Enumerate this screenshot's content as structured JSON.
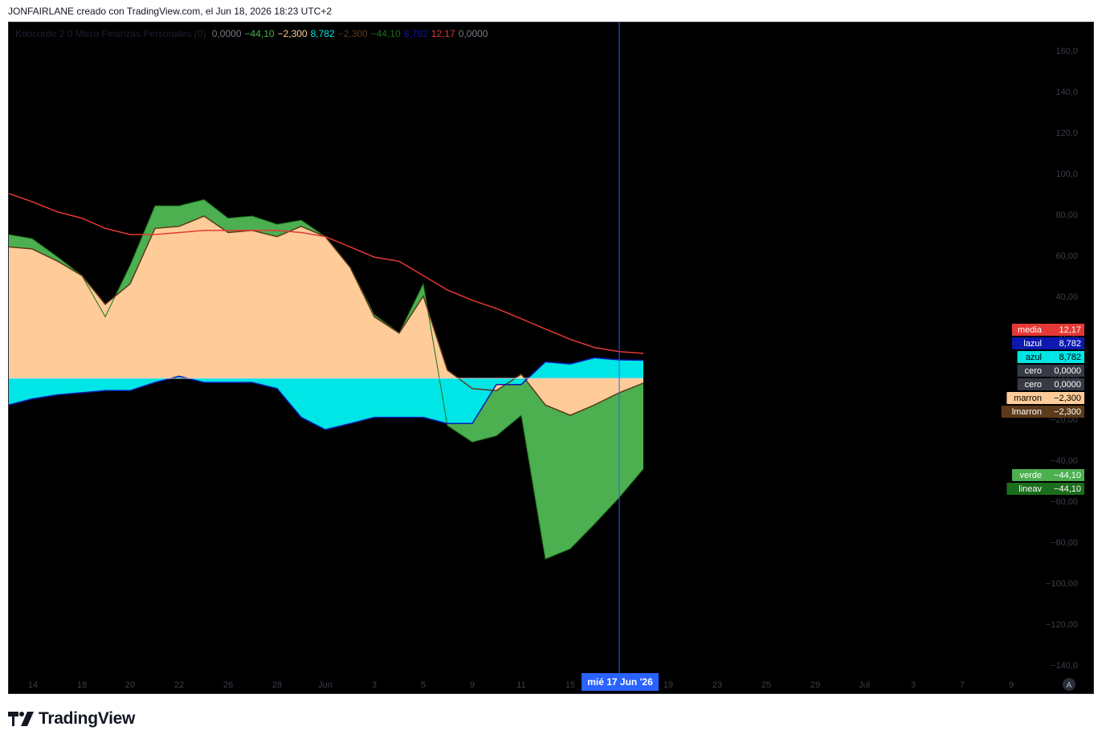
{
  "header": {
    "text": "JONFAIRLANE creado con TradingView.com, el Jun 18, 2026 18:23 UTC+2"
  },
  "legend": {
    "indicator": "Koncorde 2.0 Micro Finanzas Personales (0)",
    "values": [
      {
        "text": "0,0000",
        "color": "#787b86"
      },
      {
        "text": "−44,10",
        "color": "#4caf50"
      },
      {
        "text": "−2,300",
        "color": "#ffcc99"
      },
      {
        "text": "8,782",
        "color": "#00e5e5"
      },
      {
        "text": "−2,300",
        "color": "#5d3a1a"
      },
      {
        "text": "−44,10",
        "color": "#1b6e1b"
      },
      {
        "text": "8,782",
        "color": "#0d18b0"
      },
      {
        "text": "12,17",
        "color": "#e53935"
      },
      {
        "text": "0,0000",
        "color": "#787b86"
      }
    ]
  },
  "crosshair": {
    "date_label": "mié 17 Jun '26"
  },
  "footer": {
    "brand": "TradingView"
  },
  "chart_data": {
    "type": "area",
    "x": [
      "May 13",
      "May 15",
      "May 17",
      "May 19",
      "May 20",
      "May 21",
      "May 23",
      "May 24",
      "May 26",
      "May 28",
      "May 30",
      "Jun 1",
      "Jun 2",
      "Jun 3",
      "Jun 4",
      "Jun 5",
      "Jun 7",
      "Jun 8",
      "Jun 9",
      "Jun 10",
      "Jun 11",
      "Jun 12",
      "Jun 14",
      "Jun 15",
      "Jun 16",
      "Jun 17",
      "Jun 18"
    ],
    "x_ticks": [
      "14",
      "18",
      "20",
      "22",
      "26",
      "28",
      "Jun",
      "3",
      "5",
      "9",
      "11",
      "15",
      "19",
      "23",
      "25",
      "29",
      "Jul",
      "3",
      "7",
      "9"
    ],
    "y_ticks": [
      "160,0",
      "140,0",
      "120,0",
      "100,0",
      "80,00",
      "60,00",
      "40,00",
      "20,00",
      "0,0000",
      "−20,00",
      "−40,00",
      "−60,00",
      "−80,00",
      "−100,00",
      "−120,00",
      "−140,0"
    ],
    "ylim": [
      -140,
      160
    ],
    "series": [
      {
        "name": "verde",
        "color": "#4caf50",
        "values": [
          70,
          68,
          59,
          50,
          30,
          55,
          84,
          84,
          87,
          78,
          79,
          75,
          77,
          69,
          54,
          31,
          22,
          46,
          -23,
          -31,
          -28,
          -18,
          -88,
          -83,
          -71,
          -58,
          -44.1
        ]
      },
      {
        "name": "lineav",
        "color": "#1b6e1b",
        "values": [
          70,
          68,
          59,
          50,
          30,
          55,
          84,
          84,
          87,
          78,
          79,
          75,
          77,
          69,
          54,
          31,
          22,
          46,
          -23,
          -31,
          -28,
          -18,
          -88,
          -83,
          -71,
          -58,
          -44.1
        ]
      },
      {
        "name": "marron",
        "color": "#ffcc99",
        "values": [
          64,
          63,
          57,
          50,
          36,
          46,
          73,
          74,
          79,
          71,
          72,
          69,
          74,
          69,
          54,
          30,
          22,
          40,
          4,
          -5,
          -6,
          2,
          -13,
          -18,
          -13,
          -7,
          -2.3
        ]
      },
      {
        "name": "lmarron",
        "color": "#5d3a1a",
        "values": [
          64,
          63,
          57,
          50,
          36,
          46,
          73,
          74,
          79,
          71,
          72,
          69,
          74,
          69,
          54,
          30,
          22,
          40,
          4,
          -5,
          -6,
          2,
          -13,
          -18,
          -13,
          -7,
          -2.3
        ]
      },
      {
        "name": "azul",
        "color": "#00e5e5",
        "values": [
          -13,
          -10,
          -8,
          -7,
          -6,
          -6,
          -2,
          1,
          -2,
          -2,
          -2,
          -5,
          -19,
          -25,
          -22,
          -19,
          -19,
          -19,
          -22,
          -22,
          -3,
          -3,
          8,
          7,
          10,
          9,
          8.782
        ]
      },
      {
        "name": "lazul",
        "color": "#0d18b0",
        "values": [
          -13,
          -10,
          -8,
          -7,
          -6,
          -6,
          -2,
          1,
          -2,
          -2,
          -2,
          -5,
          -19,
          -25,
          -22,
          -19,
          -19,
          -19,
          -22,
          -22,
          -3,
          -3,
          8,
          7,
          10,
          9,
          8.782
        ]
      },
      {
        "name": "media",
        "color": "#e53935",
        "values": [
          90,
          86,
          81,
          78,
          73,
          70,
          70,
          71,
          72,
          72,
          72,
          72,
          71,
          69,
          64,
          59,
          57,
          50,
          43,
          38,
          34,
          29,
          24,
          19,
          15,
          13,
          12.17
        ]
      },
      {
        "name": "cero",
        "color": "#c8d1d8",
        "values": [
          0,
          0,
          0,
          0,
          0,
          0,
          0,
          0,
          0,
          0,
          0,
          0,
          0,
          0,
          0,
          0,
          0,
          0,
          0,
          0,
          0,
          0,
          0,
          0,
          0,
          0,
          0
        ]
      }
    ],
    "price_labels": [
      {
        "name": "media",
        "value": "12,17",
        "bg": "#e53935",
        "fg": "#ffffff"
      },
      {
        "name": "lazul",
        "value": "8,782",
        "bg": "#0d18b0",
        "fg": "#ffffff"
      },
      {
        "name": "azul",
        "value": "8,782",
        "bg": "#00e5e5",
        "fg": "#000000"
      },
      {
        "name": "cero",
        "value": "0,0000",
        "bg": "#363a45",
        "fg": "#ffffff"
      },
      {
        "name": "cero",
        "value": "0,0000",
        "bg": "#363a45",
        "fg": "#ffffff"
      },
      {
        "name": "marron",
        "value": "−2,300",
        "bg": "#ffcc99",
        "fg": "#000000"
      },
      {
        "name": "lmarron",
        "value": "−2,300",
        "bg": "#5d3a1a",
        "fg": "#ffffff"
      },
      {
        "name": "verde",
        "value": "−44,10",
        "bg": "#4caf50",
        "fg": "#ffffff"
      },
      {
        "name": "lineav",
        "value": "−44,10",
        "bg": "#1b6e1b",
        "fg": "#ffffff"
      }
    ],
    "grid": false,
    "legend": "top-left"
  }
}
